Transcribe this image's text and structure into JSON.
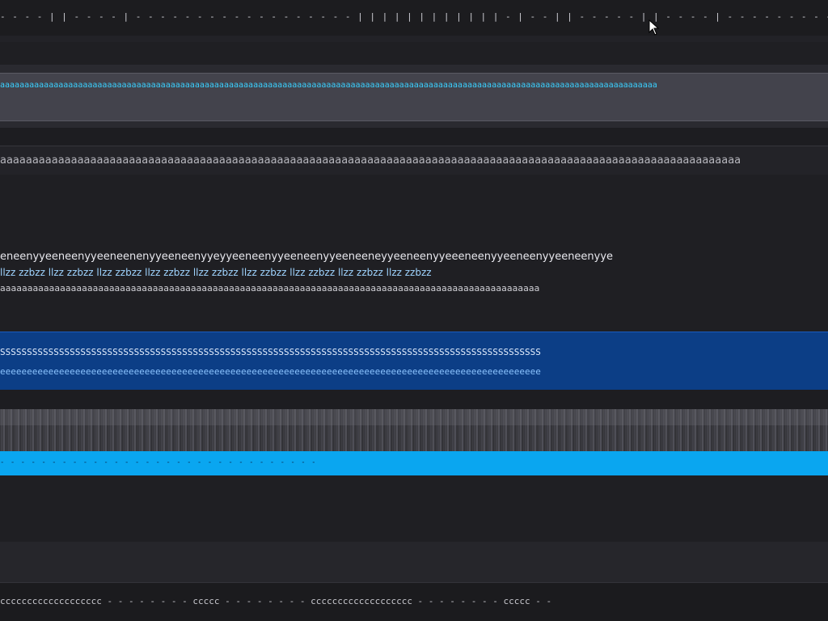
{
  "screen": {
    "top_strip_text": "- - - -   | |   - - - -   |   - - - - - - - - - - - - - -   - - - - | | | | | |   | | | | | | - | - - | |   -           - - - -   | |   - - - -   |   - - - - - - - - - - - - - - | | | | | |   | | | | | | - | - -",
    "cyan_band_text": "ааааааааааааааааааааааааааааааааааааааааааааааааааааааааааааааааааааааааааааааааааааааааааааааааааааааааааааааааааааааааааааааааааааааа",
    "gray_line_text": "aaaaaaaaaaaaaaaaaaaaaaaaaaaaaaaaaaaaaaaaaaaaaaaaaaaaaaaaaaaaaaaaaaaaaaaaaaaaaaaaaaaaaaaaaaaaaaaaaaaaaaaaaaaaaaaaaaa",
    "block_line_1": "eneenyyeeneenyyeeneenenyyeeneenyyeyyeeneenyyeeneenyyeeneeneyyeeneenyyeeeneenyyeeneenyyeeneenyye",
    "block_line_2": "llzz zzbzz llzz zzbzz llzz zzbzz llzz zzbzz llzz zzbzz llzz zzbzz llzz zzbzz llzz zzbzz llzz zzbzz",
    "block_line_3": "aaaaaaaaaaaaaaaaaaaaaaaaaaaaaaaaaaaaaaaaaaaaaaaaaaaaaaaaaaaaaaaaaaaaaaaaaaaaaaaaaaaaaaaaaaaaaaaaaaa",
    "blue_line_1": "SSSSSSSSSSSSSSSSSSSSSSSSSSSSSSSSSSSSSSSSSSSSSSSSSSSSSSSSSSSSSSSSSSSSSSSSSSSSSSSSSSSSSSSSSSSSSSSSSSSSS",
    "blue_line_2": "eeeeeeeeeeeeeeeeeeeeeeeeeeeeeeeeeeeeeeeeeeeeeeeeeeeeeeeeeeeeeeeeeeeeeeeeeeeeeeeeeeeeeeeeeeeeeeeeeeeee",
    "cyan_bar_text": "-   - -     - - -       - - -     - - - - -   - - -     - - -       - - -     - - - - -   - - -",
    "bottom_strip_text": "ccccccccccccccccccc - - - - - - - - ccccc - - - - - - - - ccccccccccccccccccc - - - - - - - - ccccc - -"
  },
  "icons": {
    "cursor": "mouse-pointer-icon"
  }
}
